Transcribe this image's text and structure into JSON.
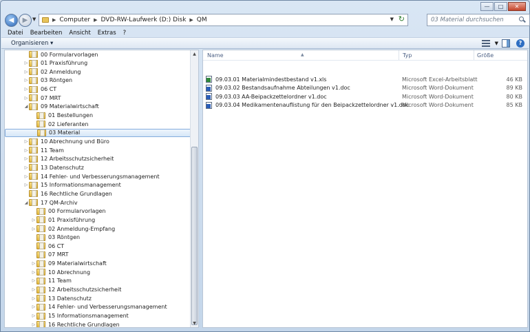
{
  "address": {
    "crumbs": [
      "Computer",
      "DVD-RW-Laufwerk (D:) Disk",
      "QM"
    ]
  },
  "search": {
    "placeholder": "03 Material durchsuchen"
  },
  "menu": [
    "Datei",
    "Bearbeiten",
    "Ansicht",
    "Extras",
    "?"
  ],
  "toolbar": {
    "organize_label": "Organisieren"
  },
  "tree": [
    {
      "label": "00 Formularvorlagen",
      "level": 1,
      "expander": "none"
    },
    {
      "label": "01 Praxisführung",
      "level": 1,
      "expander": "collapsed"
    },
    {
      "label": "02 Anmeldung",
      "level": 1,
      "expander": "collapsed"
    },
    {
      "label": "03 Röntgen",
      "level": 1,
      "expander": "collapsed"
    },
    {
      "label": "06 CT",
      "level": 1,
      "expander": "collapsed"
    },
    {
      "label": "07 MRT",
      "level": 1,
      "expander": "collapsed"
    },
    {
      "label": "09 Materialwirtschaft",
      "level": 1,
      "expander": "expanded"
    },
    {
      "label": "01 Bestellungen",
      "level": 2,
      "expander": "none"
    },
    {
      "label": "02 Lieferanten",
      "level": 2,
      "expander": "none"
    },
    {
      "label": "03 Material",
      "level": 2,
      "expander": "none",
      "selected": true
    },
    {
      "label": "10 Abrechnung und Büro",
      "level": 1,
      "expander": "collapsed"
    },
    {
      "label": "11 Team",
      "level": 1,
      "expander": "collapsed"
    },
    {
      "label": "12 Arbeitsschutzsicherheit",
      "level": 1,
      "expander": "collapsed"
    },
    {
      "label": "13 Datenschutz",
      "level": 1,
      "expander": "collapsed"
    },
    {
      "label": "14 Fehler- und Verbesserungsmanagement",
      "level": 1,
      "expander": "collapsed"
    },
    {
      "label": "15 Informationsmanagement",
      "level": 1,
      "expander": "collapsed"
    },
    {
      "label": "16 Rechtliche Grundlagen",
      "level": 1,
      "expander": "none"
    },
    {
      "label": "17 QM-Archiv",
      "level": 1,
      "expander": "expanded"
    },
    {
      "label": "00 Formularvorlagen",
      "level": 2,
      "expander": "none"
    },
    {
      "label": "01 Praxisführung",
      "level": 2,
      "expander": "collapsed"
    },
    {
      "label": "02 Anmeldung-Empfang",
      "level": 2,
      "expander": "collapsed"
    },
    {
      "label": "03 Röntgen",
      "level": 2,
      "expander": "none"
    },
    {
      "label": "06 CT",
      "level": 2,
      "expander": "none"
    },
    {
      "label": "07 MRT",
      "level": 2,
      "expander": "none"
    },
    {
      "label": "09 Materialwirtschaft",
      "level": 2,
      "expander": "collapsed"
    },
    {
      "label": "10 Abrechnung",
      "level": 2,
      "expander": "collapsed"
    },
    {
      "label": "11 Team",
      "level": 2,
      "expander": "collapsed"
    },
    {
      "label": "12 Arbeitsschutzsicherheit",
      "level": 2,
      "expander": "collapsed"
    },
    {
      "label": "13 Datenschutz",
      "level": 2,
      "expander": "collapsed"
    },
    {
      "label": "14 Fehler- und Verbesserungsmanagement",
      "level": 2,
      "expander": "collapsed"
    },
    {
      "label": "15 Informationsmanagement",
      "level": 2,
      "expander": "collapsed"
    },
    {
      "label": "16 Rechtliche Grundlagen",
      "level": 2,
      "expander": "collapsed"
    }
  ],
  "columns": {
    "name": "Name",
    "type": "Typ",
    "size": "Größe"
  },
  "files": [
    {
      "name": "09.03.01 Materialmindestbestand v1.xls",
      "type": "Microsoft Excel-Arbeitsblatt",
      "size": "46 KB",
      "icon": "excel-file-icon"
    },
    {
      "name": "09.03.02 Bestandsaufnahme Abteilungen v1.doc",
      "type": "Microsoft Word-Dokument",
      "size": "89 KB",
      "icon": "word-file-icon"
    },
    {
      "name": "09.03.03 AA-Beipackzettelordner v1.doc",
      "type": "Microsoft Word-Dokument",
      "size": "80 KB",
      "icon": "word-file-icon"
    },
    {
      "name": "09.03.04 Medikamentenauflistung für den Beipackzettelordner v1.doc",
      "type": "Microsoft Word-Dokument",
      "size": "85 KB",
      "icon": "word-file-icon"
    }
  ]
}
